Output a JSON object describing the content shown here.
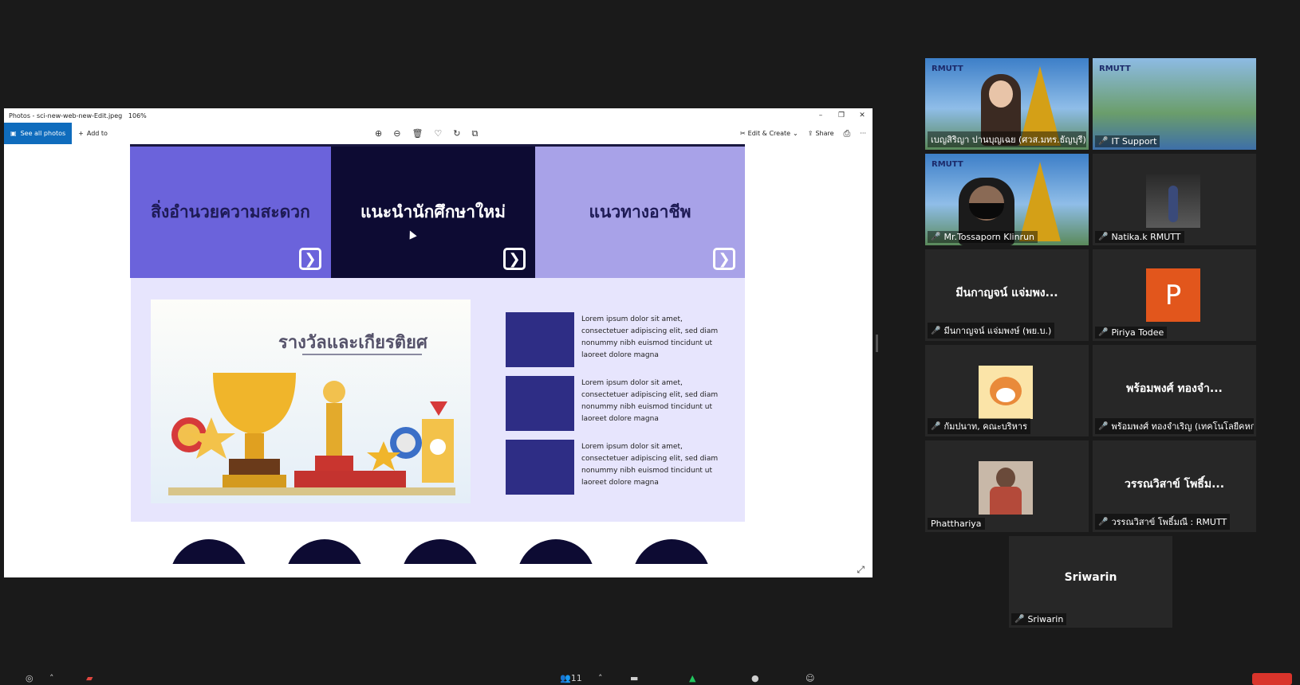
{
  "photos": {
    "title": "Photos - sci-new-web-new-Edit.jpeg",
    "zoom": "106%",
    "window_controls": [
      "–",
      "❐",
      "✕"
    ],
    "see_all_label": "See all photos",
    "add_to_label": "Add to",
    "tools": [
      "zoom-in-icon",
      "zoom-out-icon",
      "delete-icon",
      "favorite-icon",
      "rotate-icon",
      "crop-icon"
    ],
    "tool_glyphs": [
      "⊕",
      "⊖",
      "🗑",
      "♡",
      "↻",
      "⧉"
    ],
    "edit_create_label": "Edit & Create",
    "share_label": "Share",
    "more_glyph": "···",
    "print_glyph": "⎙",
    "expand_glyph": "⤢"
  },
  "slide": {
    "tiles": [
      {
        "label": "สิ่งอำนวยความสะดวก",
        "arrow": "❯"
      },
      {
        "label": "แนะนำนักศึกษาใหม่",
        "arrow": "❯"
      },
      {
        "label": "แนวทางอาชีพ",
        "arrow": "❯"
      }
    ],
    "award_title": "รางวัลและเกียรติยศ",
    "cards": [
      {
        "text": "Lorem ipsum dolor sit amet, consectetuer adipiscing elit, sed diam nonummy nibh euismod tincidunt ut laoreet dolore magna"
      },
      {
        "text": "Lorem ipsum dolor sit amet, consectetuer adipiscing elit, sed diam nonummy nibh euismod tincidunt ut laoreet dolore magna"
      },
      {
        "text": "Lorem ipsum dolor sit amet, consectetuer adipiscing elit, sed diam nonummy nibh euismod tincidunt ut laoreet dolore magna"
      }
    ],
    "circle_count": 5
  },
  "participants": [
    {
      "name": "เบญสิริญา ปานบุญเฉย (ศวส.มทร.ธัญบุรี)",
      "type": "video-woman",
      "active": true
    },
    {
      "name": "IT Support",
      "type": "video-campus",
      "muted": true
    },
    {
      "name": "Mr.Tossaporn Klinrun",
      "type": "video-man",
      "muted": true
    },
    {
      "name": "Natika.k RMUTT",
      "type": "thumb-person",
      "muted": true
    },
    {
      "name": "มีนกาญจน์ แจ่มพงษ์ (พย.บ.)",
      "big": "มีนกาญจน์ แจ่มพง...",
      "muted": true
    },
    {
      "name": "Piriya Todee",
      "type": "avatar",
      "initial": "P",
      "muted": true
    },
    {
      "name": "กัมปนาท, คณะบริหาร",
      "type": "thumb-cartoon",
      "muted": true
    },
    {
      "name": "พร้อมพงศ์ ทองจำเริญ (เทคโนโลยีคหกรรม...",
      "big": "พร้อมพงศ์ ทองจำ...",
      "muted": true
    },
    {
      "name": "Phatthariya",
      "type": "thumb-selfie",
      "muted": false
    },
    {
      "name": "วรรณวิสาข์ โพธิ์มณี : RMUTT",
      "big": "วรรณวิสาข์ โพธิ์ม...",
      "muted": true
    },
    {
      "name": "Sriwarin",
      "big": "Sriwarin",
      "muted": true
    }
  ],
  "logo_text": "RMUTT",
  "mic_off_glyph": "🎤",
  "bottom": {
    "participants_count": "11"
  },
  "colors": {
    "accent_blue": "#0f6cbd",
    "tile1": "#6b63db",
    "tile2": "#0d0b33",
    "tile3": "#a8a2e8",
    "active_speaker": "#c8e04a",
    "avatar_orange": "#e2561c"
  }
}
